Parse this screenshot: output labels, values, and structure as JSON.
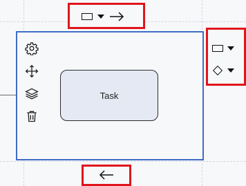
{
  "canvas": {
    "task_label": "Task"
  },
  "context_toolbar": {
    "settings_icon": "gear-icon",
    "move_icon": "move-icon",
    "layers_icon": "layers-icon",
    "delete_icon": "trash-icon"
  },
  "top_tools": {
    "shape_icon": "rectangle-icon",
    "dropdown_icon": "caret-down-icon",
    "arrow_icon": "arrow-right-icon"
  },
  "right_tools": {
    "items": [
      {
        "icon": "rectangle-icon",
        "dropdown": "caret-down-icon"
      },
      {
        "icon": "diamond-icon",
        "dropdown": "caret-down-icon"
      }
    ]
  },
  "bottom_tools": {
    "arrow_icon": "arrow-left-icon"
  },
  "colors": {
    "highlight": "#e0141b",
    "selection": "#3f6cc4",
    "task_fill": "#e4e9f3"
  }
}
